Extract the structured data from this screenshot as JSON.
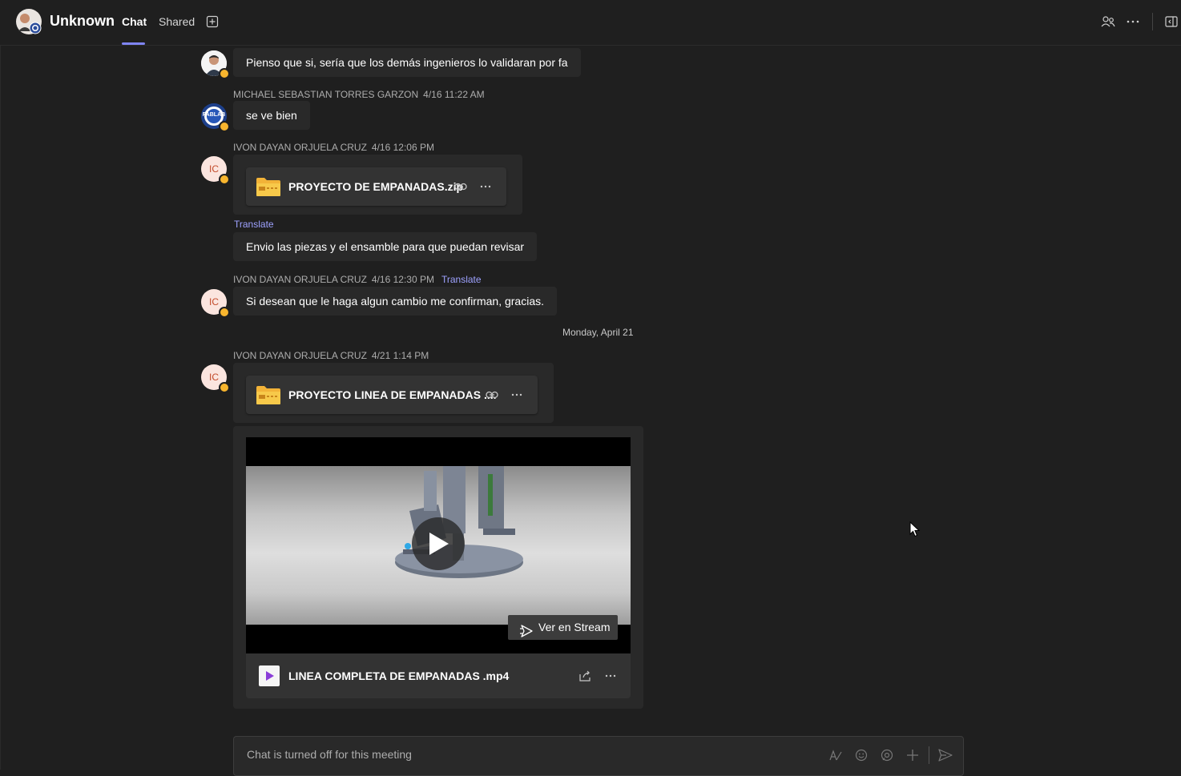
{
  "header": {
    "title": "Unknown",
    "tabs": [
      {
        "label": "Chat",
        "active": true
      },
      {
        "label": "Shared",
        "active": false
      }
    ],
    "icons": [
      "add-tab-icon",
      "participants-icon",
      "more-options-icon",
      "open-side-panel-icon"
    ]
  },
  "messages": [
    {
      "text": "Pienso que si, sería que los demás ingenieros lo validaran por fa"
    },
    {
      "sender": "MICHAEL SEBASTIAN TORRES GARZON",
      "time": "4/16 11:22 AM",
      "text": "se ve bien",
      "avatar_text": "FABLAB"
    },
    {
      "sender": "IVON DAYAN ORJUELA CRUZ",
      "time": "4/16 12:06 PM",
      "avatar_text": "IC",
      "file_name": "PROYECTO DE EMPANADAS.zip",
      "translate": "Translate",
      "text": "Envio las piezas y el ensamble para que puedan revisar"
    },
    {
      "sender": "IVON DAYAN ORJUELA CRUZ",
      "time": "4/16 12:30 PM",
      "translate": "Translate",
      "avatar_text": "IC",
      "text": "Si desean que le haga algun cambio me confirman, gracias."
    },
    {
      "sender": "IVON DAYAN ORJUELA CRUZ",
      "time": "4/21 1:14 PM",
      "avatar_text": "IC",
      "file_name": "PROYECTO LINEA DE EMPANADAS ....",
      "video_button": "Ver en Stream",
      "video_name": "LINEA COMPLETA DE EMPANADAS .mp4"
    }
  ],
  "date_divider": "Monday, April 21",
  "compose": {
    "placeholder": "Chat is turned off for this meeting"
  },
  "colors": {
    "accent": "#7f85f5",
    "link": "#9ea2ff",
    "presence_away": "#f8b52e",
    "folder": "#f2b338",
    "background": "#1f1f1f",
    "bubble": "#292929"
  }
}
